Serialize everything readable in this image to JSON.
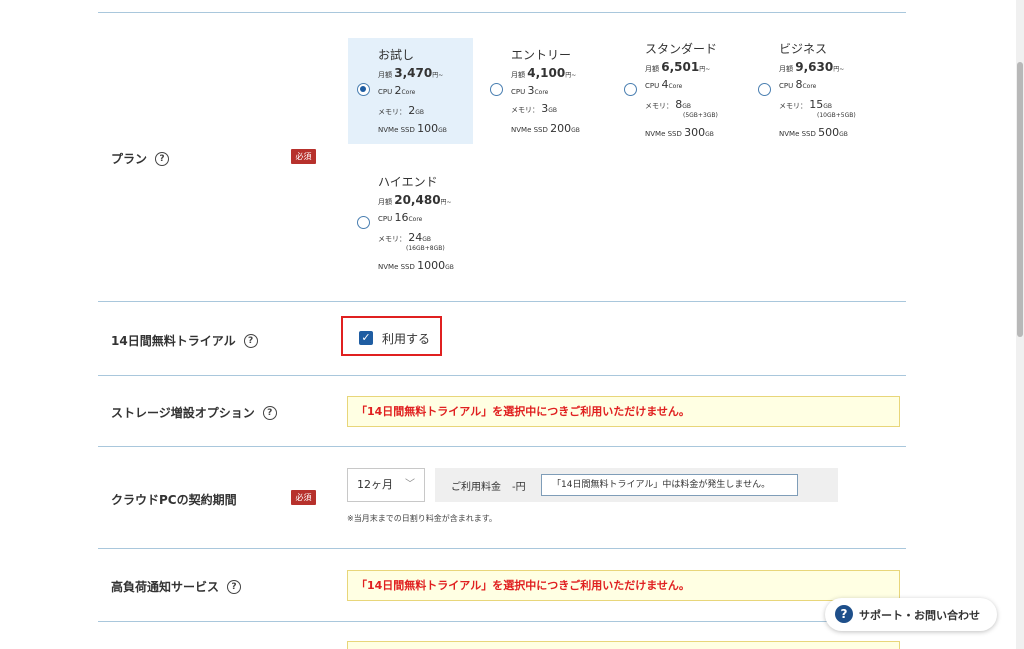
{
  "help_glyph": "?",
  "required_label": "必須",
  "rows": {
    "plan": "プラン",
    "trial": "14日間無料トライアル",
    "storage": "ストレージ増設オプション",
    "period": "クラウドPCの契約期間",
    "alert": "高負荷通知サービス"
  },
  "plan_labels": {
    "monthly": "月額",
    "yen": "円~",
    "cpu": "CPU",
    "core": "Core",
    "memory": "メモリ：",
    "gb": "GB",
    "ssd": "NVMe SSD"
  },
  "plans": [
    {
      "name": "お試し",
      "price": "3,470",
      "cpu": "2",
      "memory": "2",
      "memory_detail": "",
      "ssd": "100",
      "selected": true
    },
    {
      "name": "エントリー",
      "price": "4,100",
      "cpu": "3",
      "memory": "3",
      "memory_detail": "",
      "ssd": "200",
      "selected": false
    },
    {
      "name": "スタンダード",
      "price": "6,501",
      "cpu": "4",
      "memory": "8",
      "memory_detail": "(5GB+3GB)",
      "ssd": "300",
      "selected": false
    },
    {
      "name": "ビジネス",
      "price": "9,630",
      "cpu": "8",
      "memory": "15",
      "memory_detail": "(10GB+5GB)",
      "ssd": "500",
      "selected": false
    },
    {
      "name": "ハイエンド",
      "price": "20,480",
      "cpu": "16",
      "memory": "24",
      "memory_detail": "(16GB+8GB)",
      "ssd": "1000",
      "selected": false
    }
  ],
  "trial": {
    "checkbox_label": "利用する",
    "checked": true
  },
  "notice_text": "「14日間無料トライアル」を選択中につきご利用いただけません。",
  "period": {
    "selected": "12ヶ月",
    "fee_label": "ご利用料金",
    "fee_amount": "-円",
    "fee_field_value": "「14日間無料トライアル」中は料金が発生しません。",
    "note": "※当月末までの日割り料金が含まれます。"
  },
  "support_button": "サポート・お問い合わせ",
  "colors": {
    "accent": "#1f5da2",
    "required": "#b7312c",
    "alert_text": "#e02020",
    "notice_bg": "#ffffe3"
  }
}
